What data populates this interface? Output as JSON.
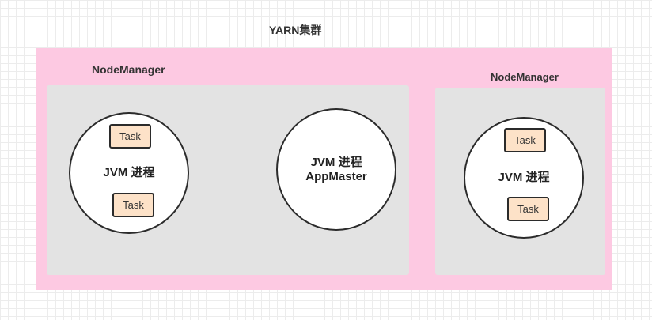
{
  "title": "YARN集群",
  "nodes": [
    {
      "label": "NodeManager",
      "processes": [
        {
          "lines": [
            "JVM 进程"
          ],
          "tasks": [
            "Task",
            "Task"
          ]
        },
        {
          "lines": [
            "JVM 进程",
            "AppMaster"
          ],
          "tasks": []
        }
      ]
    },
    {
      "label": "NodeManager",
      "processes": [
        {
          "lines": [
            "JVM 进程"
          ],
          "tasks": [
            "Task",
            "Task"
          ]
        }
      ]
    }
  ],
  "colors": {
    "cluster": "#fdc9e2",
    "node": "#e3e3e3",
    "task": "#fde2c8",
    "stroke": "#2b2b2b"
  }
}
